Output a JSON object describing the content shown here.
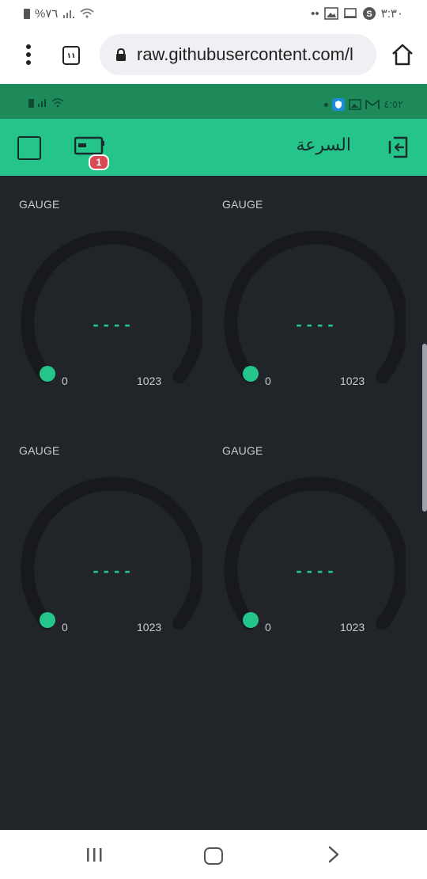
{
  "system_status": {
    "battery_text": "%٧٦",
    "time": "٣:٣٠",
    "dots": "••"
  },
  "browser": {
    "tab_count": "١١",
    "url": "raw.githubusercontent.com/l"
  },
  "app_status": {
    "time": "٤:٥٢"
  },
  "toolbar": {
    "title": "السرعة",
    "badge_count": "1"
  },
  "gauges": [
    {
      "label": "GAUGE",
      "value": "----",
      "min": "0",
      "max": "1023"
    },
    {
      "label": "GAUGE",
      "value": "----",
      "min": "0",
      "max": "1023"
    },
    {
      "label": "GAUGE",
      "value": "----",
      "min": "0",
      "max": "1023"
    },
    {
      "label": "GAUGE",
      "value": "----",
      "min": "0",
      "max": "1023"
    }
  ],
  "colors": {
    "accent": "#24c48a",
    "status_dark": "#1e8a5a",
    "dashboard_bg": "#212428",
    "gauge_track": "#17191c",
    "badge": "#d94a55"
  }
}
